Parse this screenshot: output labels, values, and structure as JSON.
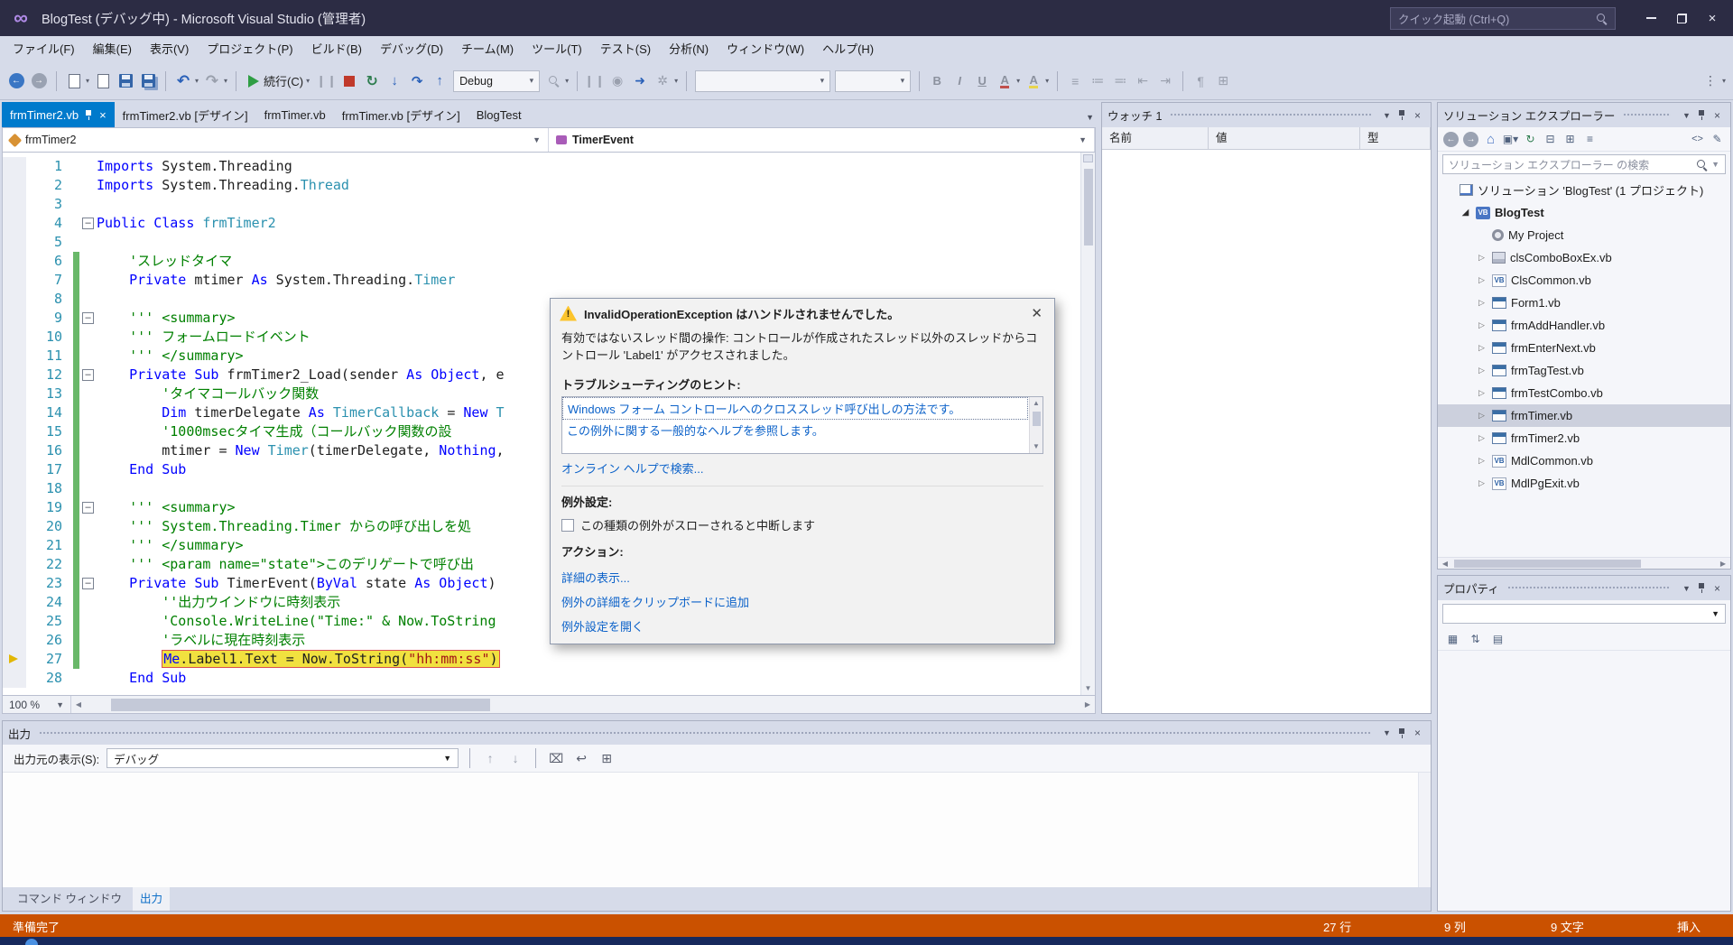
{
  "colors": {
    "accent": "#007acc",
    "debug_status_bar": "#ca5100",
    "keyword": "#0000ff",
    "type_name": "#2b91af",
    "comment": "#008000",
    "string": "#a31515",
    "current_statement_bg": "#f1e13f",
    "inactive_selection": "#ccd0dd"
  },
  "titlebar": {
    "title": "BlogTest (デバッグ中) - Microsoft Visual Studio (管理者)",
    "quick_launch_placeholder": "クイック起動 (Ctrl+Q)"
  },
  "menubar": [
    "ファイル(F)",
    "編集(E)",
    "表示(V)",
    "プロジェクト(P)",
    "ビルド(B)",
    "デバッグ(D)",
    "チーム(M)",
    "ツール(T)",
    "テスト(S)",
    "分析(N)",
    "ウィンドウ(W)",
    "ヘルプ(H)"
  ],
  "toolbar": {
    "continue_label": "続行(C)",
    "config_value": "Debug",
    "bold_label": "B",
    "italic_label": "I",
    "underline_label": "U",
    "font_color_label": "A",
    "highlight_label": "A"
  },
  "doc_tabs": [
    "frmTimer2.vb",
    "frmTimer2.vb [デザイン]",
    "frmTimer.vb",
    "frmTimer.vb [デザイン]",
    "BlogTest"
  ],
  "editor": {
    "nav_type": "frmTimer2",
    "nav_member": "TimerEvent",
    "zoom": "100 %",
    "current_line": 27,
    "lines": [
      {
        "n": 1,
        "ind": 0,
        "segs": [
          [
            "k",
            "Imports"
          ],
          [
            "p",
            " System.Threading"
          ]
        ]
      },
      {
        "n": 2,
        "ind": 0,
        "segs": [
          [
            "k",
            "Imports"
          ],
          [
            "p",
            " System.Threading."
          ],
          [
            "t",
            "Thread"
          ]
        ]
      },
      {
        "n": 3,
        "ind": 0,
        "segs": []
      },
      {
        "n": 4,
        "ind": 0,
        "fold": 1,
        "segs": [
          [
            "k",
            "Public Class"
          ],
          [
            "p",
            " "
          ],
          [
            "t",
            "frmTimer2"
          ]
        ]
      },
      {
        "n": 5,
        "ind": 0,
        "segs": []
      },
      {
        "n": 6,
        "ind": 1,
        "cb": 1,
        "segs": [
          [
            "c",
            "'スレッドタイマ"
          ]
        ]
      },
      {
        "n": 7,
        "ind": 1,
        "cb": 1,
        "segs": [
          [
            "k",
            "Private"
          ],
          [
            "p",
            " mtimer "
          ],
          [
            "k",
            "As"
          ],
          [
            "p",
            " System.Threading."
          ],
          [
            "t",
            "Timer"
          ]
        ]
      },
      {
        "n": 8,
        "ind": 0,
        "cb": 1,
        "segs": []
      },
      {
        "n": 9,
        "ind": 1,
        "cb": 1,
        "fold": 1,
        "segs": [
          [
            "c",
            "''' <summary>"
          ]
        ]
      },
      {
        "n": 10,
        "ind": 1,
        "cb": 1,
        "segs": [
          [
            "c",
            "''' フォームロードイベント"
          ]
        ]
      },
      {
        "n": 11,
        "ind": 1,
        "cb": 1,
        "segs": [
          [
            "c",
            "''' </summary>"
          ]
        ]
      },
      {
        "n": 12,
        "ind": 1,
        "cb": 1,
        "fold": 1,
        "segs": [
          [
            "k",
            "Private Sub"
          ],
          [
            "p",
            " frmTimer2_Load(sender "
          ],
          [
            "k",
            "As"
          ],
          [
            "p",
            " "
          ],
          [
            "k",
            "Object"
          ],
          [
            "p",
            ", e"
          ]
        ]
      },
      {
        "n": 13,
        "ind": 2,
        "cb": 1,
        "segs": [
          [
            "c",
            "'タイマコールバック関数"
          ]
        ]
      },
      {
        "n": 14,
        "ind": 2,
        "cb": 1,
        "segs": [
          [
            "k",
            "Dim"
          ],
          [
            "p",
            " timerDelegate "
          ],
          [
            "k",
            "As"
          ],
          [
            "p",
            " "
          ],
          [
            "t",
            "TimerCallback"
          ],
          [
            "p",
            " = "
          ],
          [
            "k",
            "New"
          ],
          [
            "p",
            " "
          ],
          [
            "t",
            "T"
          ]
        ]
      },
      {
        "n": 15,
        "ind": 2,
        "cb": 1,
        "segs": [
          [
            "c",
            "'1000msecタイマ生成（コールバック関数の設"
          ]
        ]
      },
      {
        "n": 16,
        "ind": 2,
        "cb": 1,
        "segs": [
          [
            "p",
            "mtimer = "
          ],
          [
            "k",
            "New"
          ],
          [
            "p",
            " "
          ],
          [
            "t",
            "Timer"
          ],
          [
            "p",
            "(timerDelegate, "
          ],
          [
            "k",
            "Nothing"
          ],
          [
            "p",
            ","
          ]
        ]
      },
      {
        "n": 17,
        "ind": 1,
        "cb": 1,
        "segs": [
          [
            "k",
            "End Sub"
          ]
        ]
      },
      {
        "n": 18,
        "ind": 0,
        "cb": 1,
        "segs": []
      },
      {
        "n": 19,
        "ind": 1,
        "cb": 1,
        "fold": 1,
        "segs": [
          [
            "c",
            "''' <summary>"
          ]
        ]
      },
      {
        "n": 20,
        "ind": 1,
        "cb": 1,
        "segs": [
          [
            "c",
            "''' System.Threading.Timer からの呼び出しを処"
          ]
        ]
      },
      {
        "n": 21,
        "ind": 1,
        "cb": 1,
        "segs": [
          [
            "c",
            "''' </summary>"
          ]
        ]
      },
      {
        "n": 22,
        "ind": 1,
        "cb": 1,
        "segs": [
          [
            "c",
            "''' <param name=\"state\">このデリゲートで呼び出"
          ]
        ]
      },
      {
        "n": 23,
        "ind": 1,
        "cb": 1,
        "fold": 1,
        "segs": [
          [
            "k",
            "Private Sub"
          ],
          [
            "p",
            " TimerEvent("
          ],
          [
            "k",
            "ByVal"
          ],
          [
            "p",
            " state "
          ],
          [
            "k",
            "As"
          ],
          [
            "p",
            " "
          ],
          [
            "k",
            "Object"
          ],
          [
            "p",
            ")"
          ]
        ]
      },
      {
        "n": 24,
        "ind": 2,
        "cb": 1,
        "segs": [
          [
            "c",
            "''出力ウインドウに時刻表示"
          ]
        ]
      },
      {
        "n": 25,
        "ind": 2,
        "cb": 1,
        "segs": [
          [
            "c",
            "'Console.WriteLine(\"Time:\" & Now.ToString"
          ]
        ]
      },
      {
        "n": 26,
        "ind": 2,
        "cb": 1,
        "segs": [
          [
            "c",
            "'ラベルに現在時刻表示"
          ]
        ]
      },
      {
        "n": 27,
        "ind": 2,
        "cb": 1,
        "cur": 1,
        "segs": [
          [
            "k",
            "Me"
          ],
          [
            "p",
            ".Label1.Text = Now.ToString("
          ],
          [
            "s",
            "\"hh:mm:ss\""
          ],
          [
            "p",
            ")"
          ]
        ]
      },
      {
        "n": 28,
        "ind": 1,
        "segs": [
          [
            "k",
            "End Sub"
          ]
        ]
      }
    ]
  },
  "exception_dialog": {
    "title": "InvalidOperationException はハンドルされませんでした。",
    "message": "有効ではないスレッド間の操作: コントロールが作成されたスレッド以外のスレッドからコントロール 'Label1' がアクセスされました。",
    "hints_header": "トラブルシューティングのヒント:",
    "hints": [
      "Windows フォーム コントロールへのクロススレッド呼び出しの方法です。",
      "この例外に関する一般的なヘルプを参照します。"
    ],
    "search_link": "オンライン ヘルプで検索...",
    "settings_header": "例外設定:",
    "settings_checkbox_label": "この種類の例外がスローされると中断します",
    "actions_header": "アクション:",
    "actions": [
      "詳細の表示...",
      "例外の詳細をクリップボードに追加",
      "例外設定を開く"
    ]
  },
  "watch": {
    "title": "ウォッチ 1",
    "columns": [
      "名前",
      "値",
      "型"
    ]
  },
  "solution_explorer": {
    "title": "ソリューション エクスプローラー",
    "search_placeholder": "ソリューション エクスプローラー の検索",
    "items": [
      {
        "label": "ソリューション 'BlogTest' (1 プロジェクト)",
        "level": 0,
        "arrow": "none",
        "icon": "solution"
      },
      {
        "label": "BlogTest",
        "level": 1,
        "arrow": "expanded",
        "icon": "project",
        "bold": true
      },
      {
        "label": "My Project",
        "level": 2,
        "arrow": "none",
        "icon": "myproject"
      },
      {
        "label": "clsComboBoxEx.vb",
        "level": 2,
        "arrow": "collapsed",
        "icon": "component"
      },
      {
        "label": "ClsCommon.vb",
        "level": 2,
        "arrow": "collapsed",
        "icon": "vbfile"
      },
      {
        "label": "Form1.vb",
        "level": 2,
        "arrow": "collapsed",
        "icon": "form"
      },
      {
        "label": "frmAddHandler.vb",
        "level": 2,
        "arrow": "collapsed",
        "icon": "form"
      },
      {
        "label": "frmEnterNext.vb",
        "level": 2,
        "arrow": "collapsed",
        "icon": "form"
      },
      {
        "label": "frmTagTest.vb",
        "level": 2,
        "arrow": "collapsed",
        "icon": "form"
      },
      {
        "label": "frmTestCombo.vb",
        "level": 2,
        "arrow": "collapsed",
        "icon": "form"
      },
      {
        "label": "frmTimer.vb",
        "level": 2,
        "arrow": "collapsed",
        "icon": "form",
        "selected": true
      },
      {
        "label": "frmTimer2.vb",
        "level": 2,
        "arrow": "collapsed",
        "icon": "form"
      },
      {
        "label": "MdlCommon.vb",
        "level": 2,
        "arrow": "collapsed",
        "icon": "vbfile"
      },
      {
        "label": "MdlPgExit.vb",
        "level": 2,
        "arrow": "collapsed",
        "icon": "vbfile"
      }
    ]
  },
  "properties": {
    "title": "プロパティ"
  },
  "output": {
    "title": "出力",
    "source_label": "出力元の表示(S):",
    "source_value": "デバッグ",
    "tabs": [
      "コマンド ウィンドウ",
      "出力"
    ],
    "active_tab": "出力"
  },
  "statusbar": {
    "ready": "準備完了",
    "line": "27 行",
    "column": "9 列",
    "character": "9 文字",
    "mode": "挿入"
  }
}
